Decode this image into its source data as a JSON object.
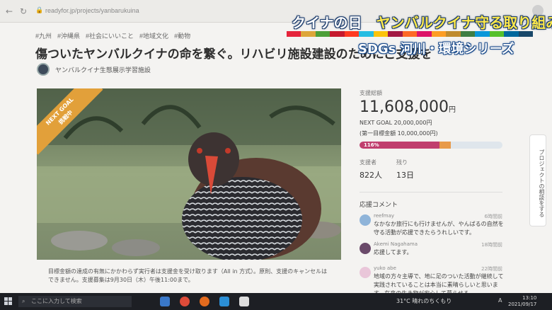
{
  "browser": {
    "url": "readyfor.jp/projects/yanbarukuina"
  },
  "tv_overlay": {
    "title_part1": "クイナの日",
    "title_part2": "ヤンバルクイナ守る取り組み",
    "subtitle": "SDGs 河川・環境シリーズ",
    "sdgs_colors": [
      "#e5243b",
      "#dda63a",
      "#4c9f38",
      "#c5192d",
      "#ff3a21",
      "#26bde2",
      "#fcc30b",
      "#a21942",
      "#fd6925",
      "#dd1367",
      "#fd9d24",
      "#bf8b2e",
      "#3f7e44",
      "#0a97d9",
      "#56c02b",
      "#00689d",
      "#19486a"
    ]
  },
  "project": {
    "tags": [
      "#九州",
      "#沖縄県",
      "#社会にいいこと",
      "#地域文化",
      "#動物"
    ],
    "title": "傷ついたヤンバルクイナの命を繋ぐ。リハビリ施設建設のためにご支援を",
    "organizer": "ヤンバルクイナ生態展示学習施設",
    "ribbon_line1": "NEXT GOAL",
    "ribbon_line2": "挑戦中",
    "caption": "目標金額の達成の有無にかかわらず実行者は支援金を受け取ります（All in 方式）。原則、支援のキャンセルはできません。支援募集は9月30日（木）午後11:00まで。"
  },
  "funding": {
    "label_total": "支援総額",
    "amount": "11,608,000",
    "currency": "円",
    "next_goal": "NEXT GOAL 20,000,000円",
    "first_goal": "(第一目標金額 10,000,000円)",
    "progress_label": "116%",
    "progress_fraction": 0.58,
    "supporters_label": "支援者",
    "supporters_value": "822人",
    "remaining_label": "残り",
    "remaining_value": "13日"
  },
  "comments": {
    "heading": "応援コメント",
    "items": [
      {
        "user": "reefmay",
        "time": "6時間前",
        "text": "なかなか旅行にも行けませんが、やんばるの自然を守る活動が応援できたらうれしいです。",
        "color": "#8fb4d9"
      },
      {
        "user": "Akemi Nagahama",
        "time": "18時間前",
        "text": "応援してます。",
        "color": "#6a4a6a"
      },
      {
        "user": "yuko abe",
        "time": "22時間前",
        "text": "地域の方々主導で、地に足のついた活動が継続して実践されていることは本当に素晴らしいと思います。在来の生き物が安心して暮らせる",
        "color": "#e9c6d9"
      }
    ]
  },
  "side_tab": "プロジェクトの相談をする",
  "taskbar": {
    "search_placeholder": "ここに入力して検索",
    "weather": "31°C 晴れのちくもり",
    "time": "13:10",
    "date": "2021/09/17",
    "ime": "A"
  }
}
